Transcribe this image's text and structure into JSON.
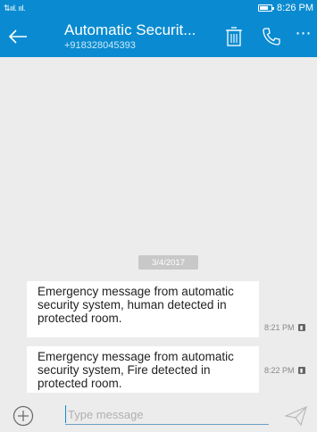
{
  "status_bar": {
    "signal_text": "⇅ııl. ııl.",
    "time": "8:26 PM"
  },
  "header": {
    "back_icon": "arrow-left-icon",
    "title": "Automatic Securit...",
    "subtitle": "+918328045393",
    "delete_icon": "trash-icon",
    "call_icon": "phone-icon",
    "more_icon": "more-icon"
  },
  "conversation": {
    "date_divider": "3/4/2017",
    "messages": [
      {
        "text": "Emergency message from automatic security system, human detected in protected room.",
        "time": "8:21 PM"
      },
      {
        "text": "Emergency message from automatic security system, Fire detected in protected room.",
        "time": "8:22 PM"
      }
    ]
  },
  "compose": {
    "add_icon": "add-circle-icon",
    "placeholder": "Type message",
    "send_icon": "send-icon"
  },
  "colors": {
    "accent": "#0a8bd1",
    "background": "#ececec",
    "bubble": "#ffffff"
  }
}
